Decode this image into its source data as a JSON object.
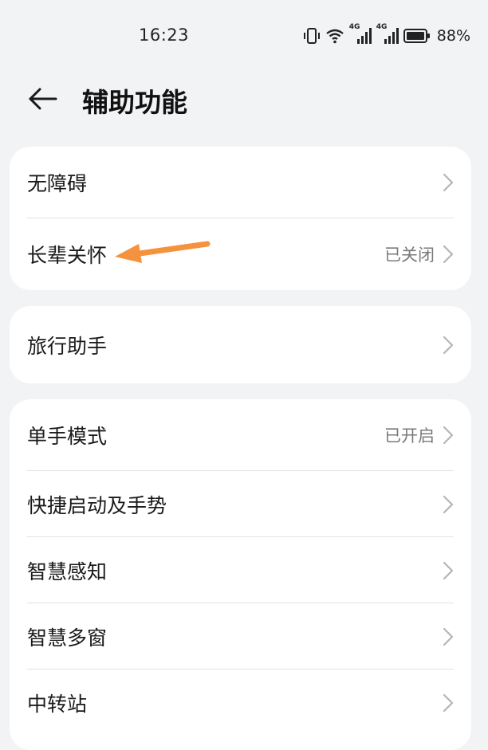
{
  "status_bar": {
    "time": "16:23",
    "signal_1_label": "4G",
    "signal_2_label": "4G",
    "battery_percent": "88%"
  },
  "header": {
    "title": "辅助功能",
    "back_icon": "arrow-left-icon"
  },
  "groups": [
    {
      "items": [
        {
          "label": "无障碍",
          "status": ""
        },
        {
          "label": "长辈关怀",
          "status": "已关闭"
        }
      ]
    },
    {
      "items": [
        {
          "label": "旅行助手",
          "status": ""
        }
      ]
    },
    {
      "items": [
        {
          "label": "单手模式",
          "status": "已开启"
        },
        {
          "label": "快捷启动及手势",
          "status": ""
        },
        {
          "label": "智慧感知",
          "status": ""
        },
        {
          "label": "智慧多窗",
          "status": ""
        },
        {
          "label": "中转站",
          "status": ""
        }
      ]
    }
  ],
  "colors": {
    "background": "#f1f3f5",
    "card": "#ffffff",
    "annotation_arrow": "#f5923e"
  }
}
